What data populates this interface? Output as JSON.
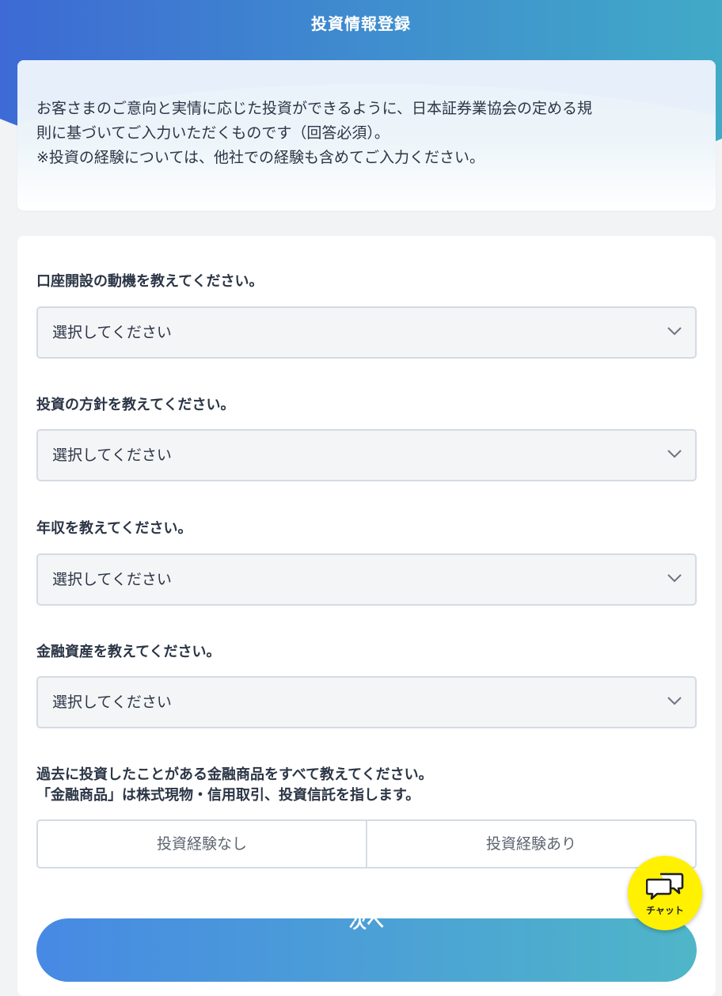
{
  "header": {
    "title": "投資情報登録"
  },
  "intro": {
    "line1": "お客さまのご意向と実情に応じた投資ができるように、日本証券業協会の定める規",
    "line2": "則に基づいてご入力いただくものです（回答必須）。",
    "line3": "※投資の経験については、他社での経験も含めてご入力ください。"
  },
  "questions": [
    {
      "label": "口座開設の動機を教えてください。",
      "value": "選択してください"
    },
    {
      "label": "投資の方針を教えてください。",
      "value": "選択してください"
    },
    {
      "label": "年収を教えてください。",
      "value": "選択してください"
    },
    {
      "label": "金融資産を教えてください。",
      "value": "選択してください"
    }
  ],
  "experience": {
    "label_line1": "過去に投資したことがある金融商品をすべて教えてください。",
    "label_line2": "「金融商品」は株式現物・信用取引、投資信託を指します。",
    "options": [
      "投資経験なし",
      "投資経験あり"
    ]
  },
  "next_button": {
    "label": "次へ"
  },
  "chat": {
    "label": "チャット",
    "icon": "chat-bubbles-icon"
  },
  "colors": {
    "header_gradient_start": "#3d6fd6",
    "header_gradient_end": "#41a8c8",
    "chat_fab": "#fff100",
    "text": "#2b3545"
  }
}
